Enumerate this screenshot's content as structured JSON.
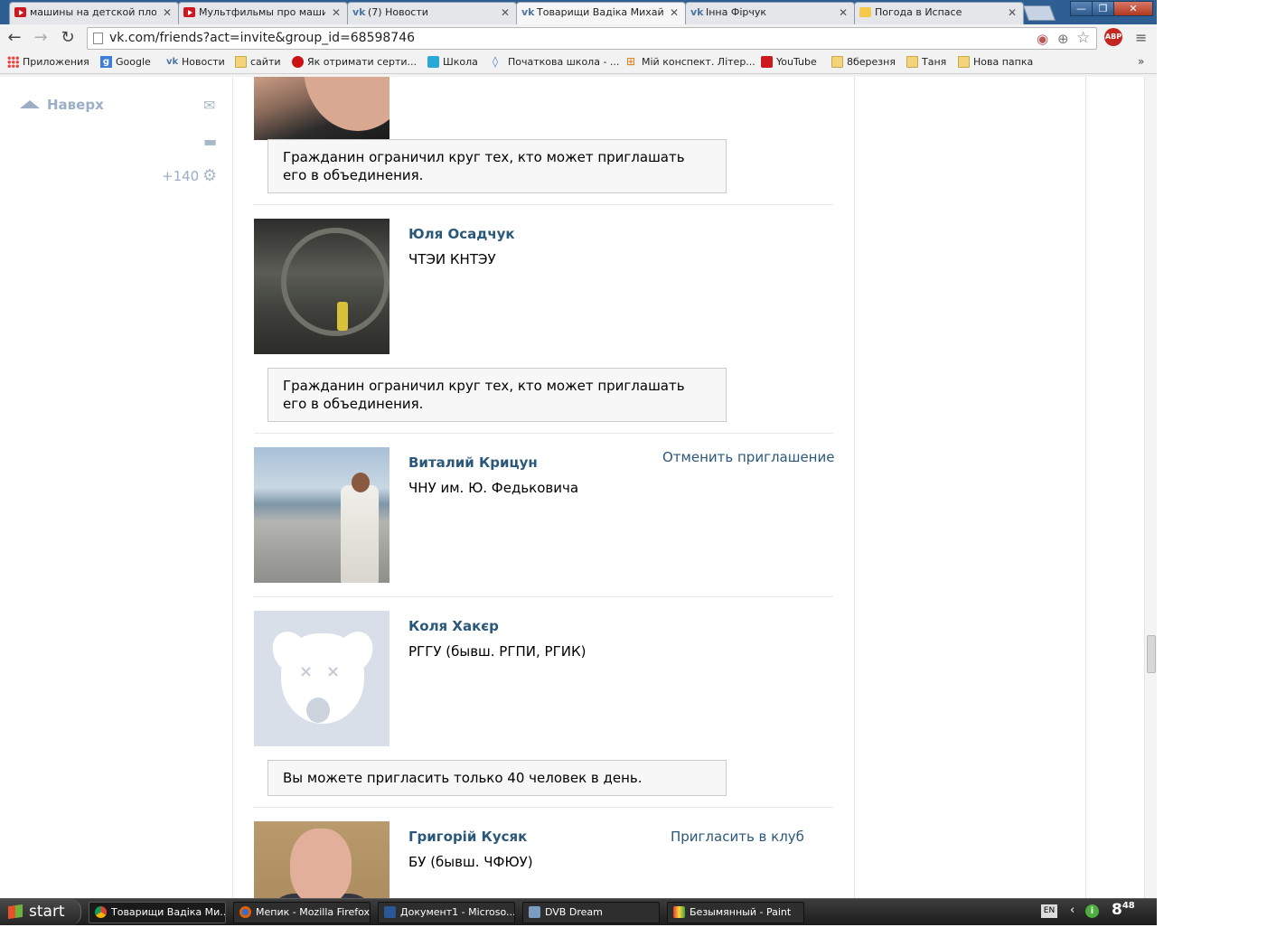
{
  "browser": {
    "tabs": [
      {
        "title": "машины на детской пло",
        "icon": "youtube-icon"
      },
      {
        "title": "Мультфильмы про маши",
        "icon": "youtube-icon"
      },
      {
        "title": "(7) Новости",
        "icon": "vk-icon"
      },
      {
        "title": "Товарищи Вадіка Михайл",
        "icon": "vk-icon",
        "active": true
      },
      {
        "title": "Інна Фірчук",
        "icon": "vk-icon"
      },
      {
        "title": "Погода в Испасе",
        "icon": "weather-icon"
      }
    ],
    "url": "vk.com/friends?act=invite&group_id=68598746",
    "bookmarks": [
      {
        "label": "Приложения",
        "icon": "apps-icon"
      },
      {
        "label": "Google",
        "icon": "google-icon"
      },
      {
        "label": "Новости",
        "icon": "vk-icon"
      },
      {
        "label": "сайти",
        "icon": "folder-icon"
      },
      {
        "label": "Як отримати серти...",
        "icon": "red-circle-icon"
      },
      {
        "label": "Школа",
        "icon": "school-icon"
      },
      {
        "label": "Початкова школа - ...",
        "icon": "diamond-icon"
      },
      {
        "label": "Мій конспект. Літер...",
        "icon": "cart-icon"
      },
      {
        "label": "YouTube",
        "icon": "youtube-icon"
      },
      {
        "label": "8березня",
        "icon": "folder-icon"
      },
      {
        "label": "Таня",
        "icon": "folder-icon"
      },
      {
        "label": "Нова папка",
        "icon": "folder-icon"
      }
    ],
    "bookmarks_more": "»",
    "window_controls": {
      "minimize": "—",
      "restore": "❐",
      "close": "✕"
    }
  },
  "sidebar": {
    "up_label": "Наверх",
    "counter": "+140"
  },
  "friends": [
    {
      "name": "",
      "university": "",
      "notice": "Гражданин ограничил круг тех, кто может приглашать его в объединения."
    },
    {
      "name": "Юля Осадчук",
      "university": "ЧТЭИ КНТЭУ",
      "notice": "Гражданин ограничил круг тех, кто может приглашать его в объединения."
    },
    {
      "name": "Виталий Крицун",
      "university": "ЧНУ им. Ю. Федьковича",
      "action": "Отменить приглашение"
    },
    {
      "name": "Коля Хакєр",
      "university": "РГГУ (бывш. РГПИ, РГИК)",
      "notice": "Вы можете пригласить только 40 человек в день."
    },
    {
      "name": "Григорій Кусяк",
      "university": "БУ (бывш. ЧФЮУ)",
      "action": "Пригласить в клуб"
    }
  ],
  "taskbar": {
    "start_label": "start",
    "tasks": [
      {
        "label": "Товарищи Вадіка Ми...",
        "icon": "chrome-icon",
        "active": true
      },
      {
        "label": "Мепик - Mozilla Firefox",
        "icon": "firefox-icon"
      },
      {
        "label": "Документ1 - Microso...",
        "icon": "word-icon"
      },
      {
        "label": "DVB Dream",
        "icon": "dvb-icon"
      },
      {
        "label": "Безымянный - Paint",
        "icon": "paint-icon"
      }
    ],
    "language": "EN",
    "clock_hour": "8",
    "clock_min": "48"
  }
}
